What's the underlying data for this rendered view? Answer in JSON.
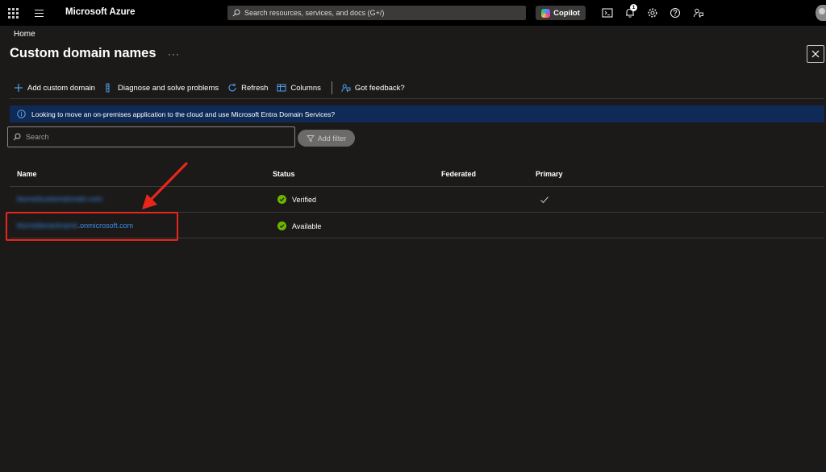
{
  "topbar": {
    "brand": "Microsoft Azure",
    "search_placeholder": "Search resources, services, and docs (G+/)",
    "copilot_label": "Copilot",
    "notification_count": "1",
    "icons": [
      "waffle-icon",
      "hamburger-icon",
      "cloud-shell-icon",
      "bell-icon",
      "gear-icon",
      "help-icon",
      "feedback-icon"
    ]
  },
  "breadcrumb": {
    "home": "Home"
  },
  "page": {
    "title": "Custom domain names",
    "more": "···"
  },
  "toolbar": {
    "add_custom_domain": "Add custom domain",
    "diagnose": "Diagnose and solve problems",
    "refresh": "Refresh",
    "columns": "Columns",
    "feedback": "Got feedback?"
  },
  "banner": {
    "text": "Looking to move an on-premises application to the cloud and use Microsoft Entra Domain Services?"
  },
  "filter": {
    "search_placeholder": "Search",
    "add_filter": "Add filter"
  },
  "table": {
    "columns": {
      "name": "Name",
      "status": "Status",
      "federated": "Federated",
      "primary": "Primary"
    },
    "rows": [
      {
        "name_redacted": "blurredcustomdomain.com",
        "name_suffix": "",
        "status": "Verified",
        "federated": "",
        "primary": "✓"
      },
      {
        "name_redacted": "blurredtenantname",
        "name_suffix": ".onmicrosoft.com",
        "status": "Available",
        "federated": "",
        "primary": ""
      }
    ]
  },
  "colors": {
    "background": "#1b1a19",
    "topbar": "#000000",
    "banner": "#0f2a57",
    "link": "#3b8bea",
    "success": "#6bb700",
    "annotation": "#e8261b"
  }
}
